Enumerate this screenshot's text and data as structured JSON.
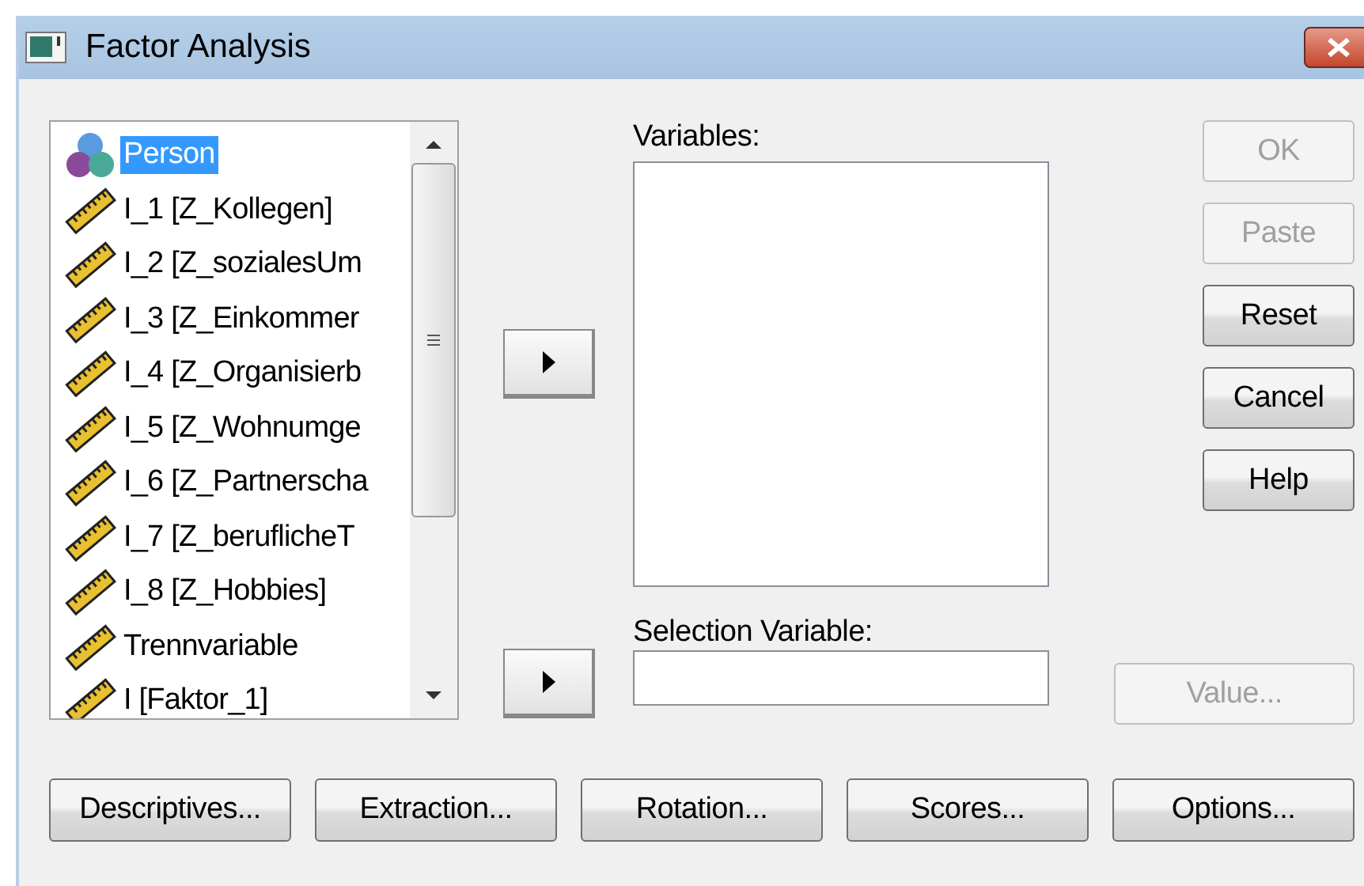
{
  "window": {
    "title": "Factor Analysis"
  },
  "variable_list": {
    "items": [
      {
        "label": "Person",
        "kind": "nominal",
        "selected": true
      },
      {
        "label": "I_1 [Z_Kollegen]",
        "kind": "scale",
        "selected": false
      },
      {
        "label": "I_2 [Z_sozialesUm",
        "kind": "scale",
        "selected": false
      },
      {
        "label": "I_3 [Z_Einkommer",
        "kind": "scale",
        "selected": false
      },
      {
        "label": "I_4 [Z_Organisierb",
        "kind": "scale",
        "selected": false
      },
      {
        "label": "I_5 [Z_Wohnumge",
        "kind": "scale",
        "selected": false
      },
      {
        "label": "I_6 [Z_Partnerscha",
        "kind": "scale",
        "selected": false
      },
      {
        "label": "I_7 [Z_beruflicheT",
        "kind": "scale",
        "selected": false
      },
      {
        "label": "I_8 [Z_Hobbies]",
        "kind": "scale",
        "selected": false
      },
      {
        "label": "Trennvariable",
        "kind": "scale",
        "selected": false
      },
      {
        "label": "I [Faktor_1]",
        "kind": "scale",
        "selected": false
      }
    ]
  },
  "variables": {
    "label": "Variables:"
  },
  "selection_variable": {
    "label": "Selection Variable:"
  },
  "side_buttons": [
    {
      "label": "OK",
      "disabled": true
    },
    {
      "label": "Paste",
      "disabled": true
    },
    {
      "label": "Reset",
      "disabled": false
    },
    {
      "label": "Cancel",
      "disabled": false
    },
    {
      "label": "Help",
      "disabled": false
    }
  ],
  "value_button": {
    "label": "Value...",
    "disabled": true
  },
  "bottom_buttons": [
    {
      "label": "Descriptives...",
      "disabled": false
    },
    {
      "label": "Extraction...",
      "disabled": false
    },
    {
      "label": "Rotation...",
      "disabled": false
    },
    {
      "label": "Scores...",
      "disabled": false
    },
    {
      "label": "Options...",
      "disabled": false
    }
  ]
}
